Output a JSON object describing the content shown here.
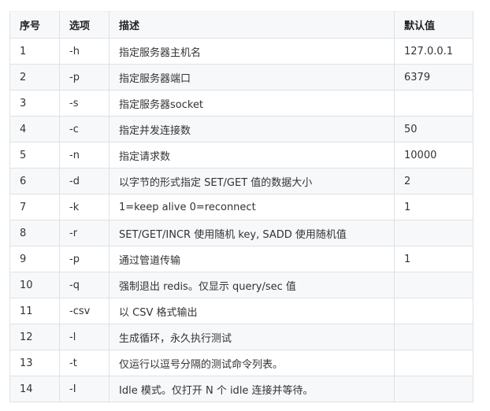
{
  "table": {
    "headers": [
      "序号",
      "选项",
      "描述",
      "默认值"
    ],
    "rows": [
      [
        "1",
        "-h",
        "指定服务器主机名",
        "127.0.0.1"
      ],
      [
        "2",
        "-p",
        "指定服务器端口",
        "6379"
      ],
      [
        "3",
        "-s",
        "指定服务器socket",
        ""
      ],
      [
        "4",
        "-c",
        "指定并发连接数",
        "50"
      ],
      [
        "5",
        "-n",
        "指定请求数",
        "10000"
      ],
      [
        "6",
        "-d",
        "以字节的形式指定 SET/GET 值的数据大小",
        "2"
      ],
      [
        "7",
        "-k",
        "1=keep alive 0=reconnect",
        "1"
      ],
      [
        "8",
        "-r",
        "SET/GET/INCR 使用随机 key, SADD 使用随机值",
        ""
      ],
      [
        "9",
        "-p",
        "通过管道传输",
        "1"
      ],
      [
        "10",
        "-q",
        "强制退出 redis。仅显示 query/sec 值",
        ""
      ],
      [
        "11",
        "-csv",
        "以 CSV 格式输出",
        ""
      ],
      [
        "12",
        "-l",
        "生成循环，永久执行测试",
        ""
      ],
      [
        "13",
        "-t",
        "仅运行以逗号分隔的测试命令列表。",
        ""
      ],
      [
        "14",
        "-I",
        "Idle 模式。仅打开 N 个 idle 连接并等待。",
        ""
      ]
    ]
  }
}
